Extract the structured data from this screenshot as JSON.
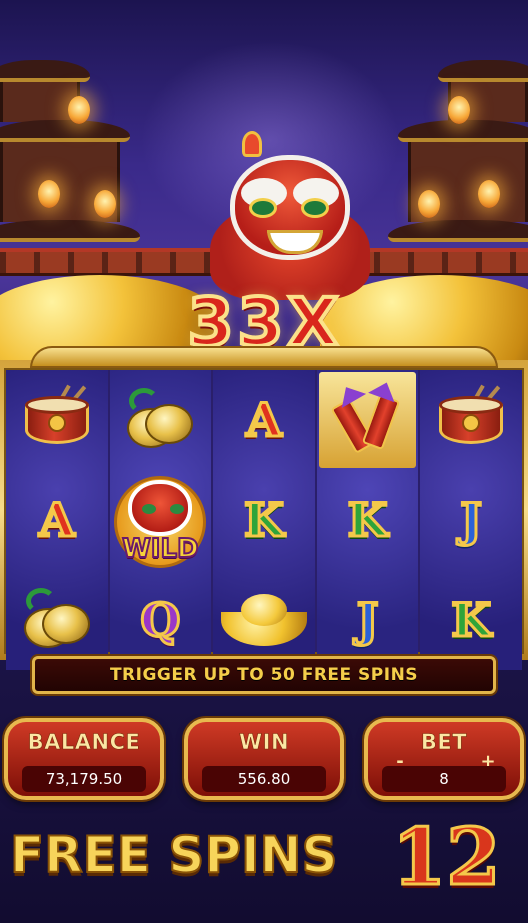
{
  "multiplier": "33X",
  "reels": [
    [
      "drum",
      "A",
      "cymbal"
    ],
    [
      "cymbal",
      "wild",
      "Q"
    ],
    [
      "A",
      "K",
      "ingot"
    ],
    [
      "rocket",
      "K",
      "J"
    ],
    [
      "drum",
      "J",
      "K"
    ]
  ],
  "wild_label": "WILD",
  "banner": "TRIGGER UP TO 50 FREE SPINS",
  "balance": {
    "label": "BALANCE",
    "value": "73,179.50"
  },
  "win": {
    "label": "WIN",
    "value": "556.80"
  },
  "bet": {
    "label": "BET",
    "value": "8",
    "minus": "-",
    "plus": "+"
  },
  "free_spins": {
    "label": "FREE SPINS",
    "count": "12"
  },
  "colors": {
    "gold": "#f5ce4a",
    "panel_red": "#cf3a25",
    "reel_bg": "#2a2480"
  }
}
